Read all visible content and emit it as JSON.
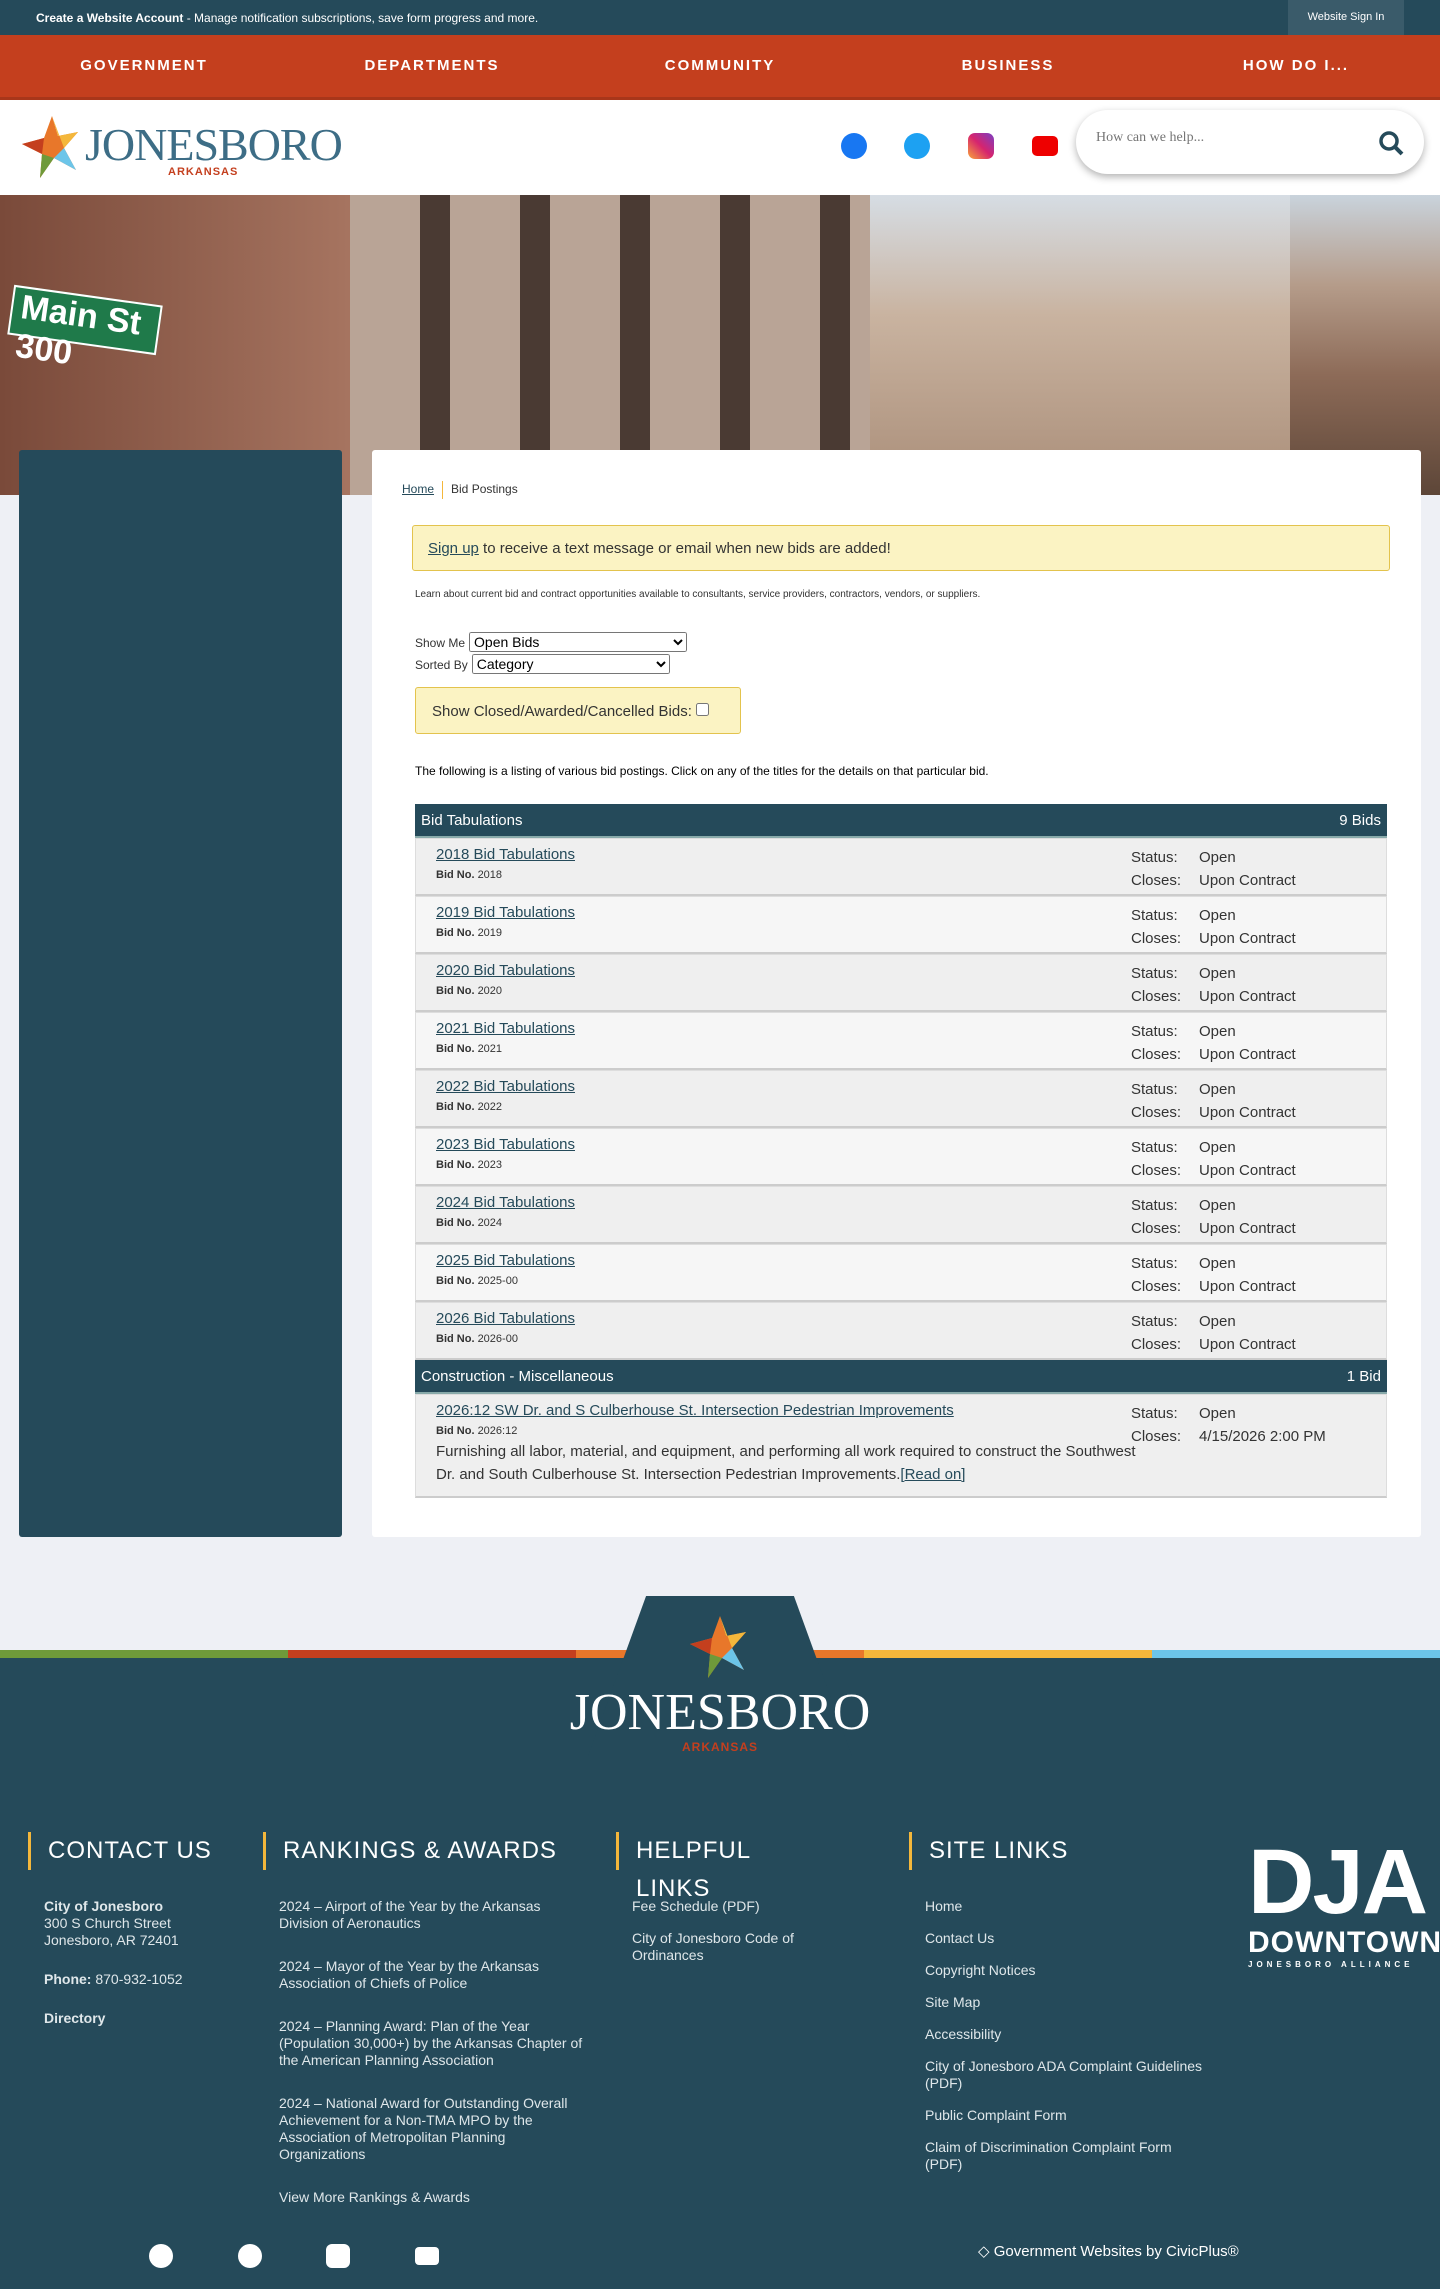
{
  "topbar": {
    "create_account": "Create a Website Account",
    "message": " - Manage notification subscriptions, save form progress and more.",
    "sign_in": "Website Sign In"
  },
  "nav": [
    "GOVERNMENT",
    "DEPARTMENTS",
    "COMMUNITY",
    "BUSINESS",
    "HOW DO I..."
  ],
  "logo": {
    "word": "JONESBORO",
    "sub": "ARKANSAS"
  },
  "search": {
    "placeholder": "How can we help..."
  },
  "hero": {
    "sign": "Main St 300"
  },
  "breadcrumb": {
    "home": "Home",
    "current": "Bid Postings"
  },
  "notice": {
    "link": "Sign up",
    "text": " to receive a text message or email when new bids are added!"
  },
  "description": "Learn about current bid and contract opportunities available to consultants, service providers, contractors, vendors, or suppliers.",
  "filters": {
    "show_me_label": "Show Me",
    "show_me_value": "Open Bids",
    "sorted_by_label": "Sorted By",
    "sorted_by_value": "Category",
    "closed_label": "Show Closed/Awarded/Cancelled Bids:"
  },
  "listing_intro": "The following is a listing of various bid postings. Click on any of the titles for the details on that particular bid.",
  "labels": {
    "bid_no": "Bid No.",
    "status": "Status:",
    "closes": "Closes:",
    "read_on": "[Read on]"
  },
  "categories": [
    {
      "name": "Bid Tabulations",
      "count": "9 Bids",
      "bids": [
        {
          "title": "2018 Bid Tabulations",
          "no": "2018",
          "status": "Open",
          "closes": "Upon Contract"
        },
        {
          "title": "2019 Bid Tabulations",
          "no": "2019",
          "status": "Open",
          "closes": "Upon Contract"
        },
        {
          "title": "2020 Bid Tabulations",
          "no": "2020",
          "status": "Open",
          "closes": "Upon Contract"
        },
        {
          "title": "2021 Bid Tabulations",
          "no": "2021",
          "status": "Open",
          "closes": "Upon Contract"
        },
        {
          "title": "2022 Bid Tabulations",
          "no": "2022",
          "status": "Open",
          "closes": "Upon Contract"
        },
        {
          "title": "2023 Bid Tabulations",
          "no": "2023",
          "status": "Open",
          "closes": "Upon Contract"
        },
        {
          "title": "2024 Bid Tabulations",
          "no": "2024",
          "status": "Open",
          "closes": "Upon Contract"
        },
        {
          "title": "2025 Bid Tabulations",
          "no": "2025-00",
          "status": "Open",
          "closes": "Upon Contract"
        },
        {
          "title": "2026 Bid Tabulations",
          "no": "2026-00",
          "status": "Open",
          "closes": "Upon Contract"
        }
      ]
    },
    {
      "name": "Construction - Miscellaneous",
      "count": "1 Bid",
      "bids": [
        {
          "title": "2026:12 SW Dr. and S Culberhouse St. Intersection Pedestrian Improvements",
          "no": "2026:12",
          "status": "Open",
          "closes": "4/15/2026 2:00 PM",
          "description": "Furnishing all labor, material, and equipment, and performing all work required to construct the Southwest Dr. and South Culberhouse St. Intersection Pedestrian Improvements."
        }
      ]
    }
  ],
  "footer": {
    "logo_word": "JONESBORO",
    "logo_sub": "ARKANSAS",
    "contact": {
      "heading": "CONTACT US",
      "name": "City of Jonesboro",
      "street": "300 S Church Street",
      "city": "Jonesboro, AR 72401",
      "phone_label": "Phone:",
      "phone": " 870-932-1052",
      "directory": "Directory"
    },
    "rankings": {
      "heading": "RANKINGS & AWARDS",
      "items": [
        "2024 – Airport of the Year by the Arkansas Division of Aeronautics",
        "2024 – Mayor of the Year by the Arkansas Association of Chiefs of Police",
        "2024 – Planning Award: Plan of the Year (Population 30,000+) by the Arkansas Chapter of the American Planning Association",
        "2024 – National Award for Outstanding Overall Achievement for a Non-TMA MPO by the Association of Metropolitan Planning Organizations",
        "View More Rankings & Awards"
      ]
    },
    "helpful": {
      "heading": "HELPFUL LINKS",
      "items": [
        "Fee Schedule (PDF)",
        "City of Jonesboro Code of Ordinances"
      ]
    },
    "site": {
      "heading": "SITE LINKS",
      "items": [
        "Home",
        "Contact Us",
        "Copyright Notices",
        "Site Map",
        "Accessibility",
        "City of Jonesboro ADA Complaint Guidelines (PDF)",
        "Public Complaint Form",
        "Claim of Discrimination Complaint Form (PDF)"
      ]
    },
    "dja": {
      "title": "DJA",
      "sub": "DOWNTOWN",
      "tag": "JONESBORO ALLIANCE"
    },
    "civicplus": "Government Websites by CivicPlus®"
  },
  "colors": {
    "teal": "#254a5a",
    "orange": "#c43f1e",
    "yellow": "#f4b73b"
  }
}
